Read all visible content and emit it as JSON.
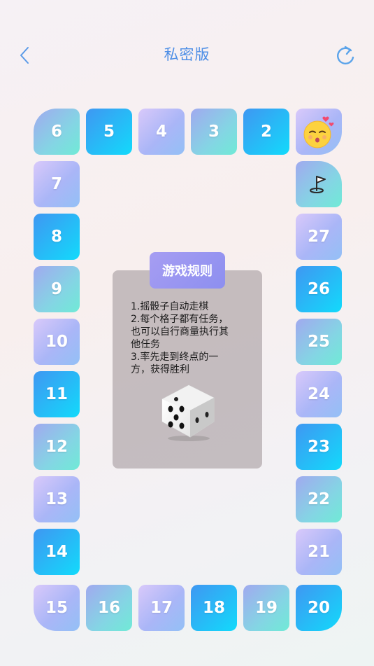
{
  "header": {
    "title": "私密版",
    "back_icon": "chevron-left-icon",
    "refresh_icon": "refresh-icon"
  },
  "board": {
    "start_icon": "kissing-face-emoji-icon",
    "finish_icon": "flag-icon",
    "tiles": {
      "t2": "2",
      "t3": "3",
      "t4": "4",
      "t5": "5",
      "t6": "6",
      "t7": "7",
      "t8": "8",
      "t9": "9",
      "t10": "10",
      "t11": "11",
      "t12": "12",
      "t13": "13",
      "t14": "14",
      "t15": "15",
      "t16": "16",
      "t17": "17",
      "t18": "18",
      "t19": "19",
      "t20": "20",
      "t21": "21",
      "t22": "22",
      "t23": "23",
      "t24": "24",
      "t25": "25",
      "t26": "26",
      "t27": "27"
    }
  },
  "rules": {
    "title": "游戏规则",
    "lines": [
      "1.摇骰子自动走棋",
      "2.每个格子都有任务，",
      "也可以自行商量执行其",
      "他任务",
      "3.率先走到终点的一",
      "方，获得胜利"
    ],
    "dice_icon": "dice-icon"
  },
  "colors": {
    "accent": "#4f8fe6",
    "tile_cyan_start": "#3f97f2",
    "tile_cyan_end": "#12dafb",
    "tile_purple": "#aab6f7",
    "tile_teal": "#70ead6",
    "rules_header": "#9696f1"
  }
}
